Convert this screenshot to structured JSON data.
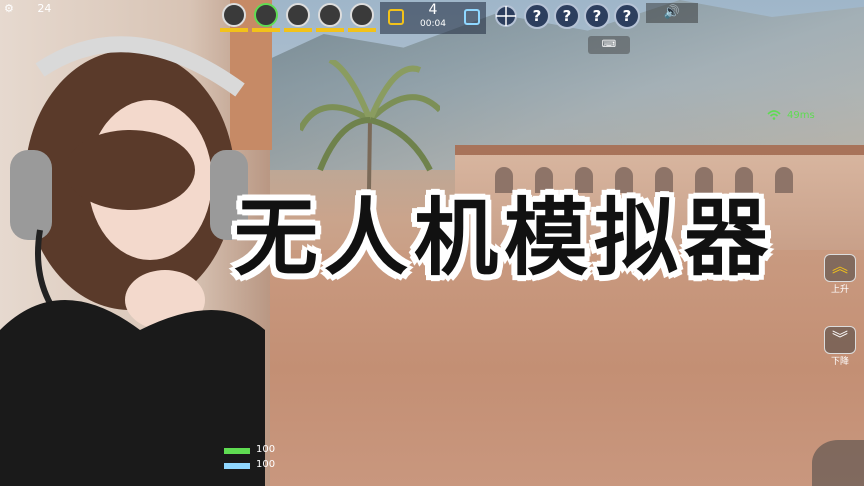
{
  "overlay_title": "无人机模拟器",
  "hud": {
    "top_left_text": "24",
    "score": {
      "value": "4",
      "time": "00:04"
    },
    "help_buttons": [
      "?",
      "?",
      "?",
      "?"
    ],
    "keyboard_label": "⌨",
    "sound_icon": "🔊",
    "ping": "49ms",
    "ascend_label": "上升",
    "descend_label": "下降",
    "health": "100",
    "armor": "100"
  },
  "colors": {
    "accent_green": "#5fdc52",
    "accent_yellow": "#f2c21a",
    "title_fill": "#111111",
    "title_outline": "#ffffff"
  }
}
